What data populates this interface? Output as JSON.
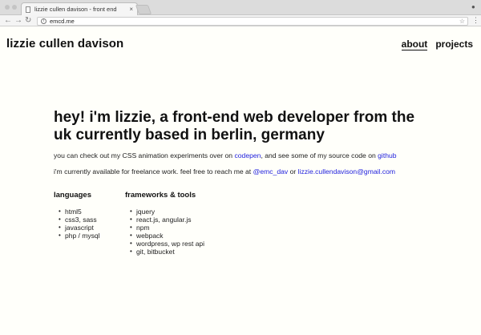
{
  "browser": {
    "tab_title": "lizzie cullen davison - front end",
    "tab_close": "×",
    "url": "emcd.me",
    "back": "←",
    "forward": "→",
    "reload": "↻",
    "star": "☆",
    "menu": "⋮",
    "info": "i"
  },
  "header": {
    "site_title": "lizzie cullen davison",
    "nav": [
      {
        "label": "about",
        "active": true
      },
      {
        "label": "projects",
        "active": false
      }
    ]
  },
  "main": {
    "heading": "hey! i'm lizzie, a front-end web developer from the uk currently based in berlin, germany",
    "para1": {
      "before": "you can check out my CSS animation experiments over on ",
      "link1": "codepen",
      "middle": ", and see some of my source code on ",
      "link2": "github"
    },
    "para2": {
      "before": "i'm currently available for freelance work. feel free to reach me at ",
      "link1": "@emc_dav",
      "middle": " or ",
      "link2": "lizzie.cullendavison@gmail.com"
    },
    "languages": {
      "title": "languages",
      "items": [
        "html5",
        "css3, sass",
        "javascript",
        "php / mysql"
      ]
    },
    "frameworks": {
      "title": "frameworks & tools",
      "items": [
        "jquery",
        "react.js, angular.js",
        "npm",
        "webpack",
        "wordpress, wp rest api",
        "git, bitbucket"
      ]
    }
  },
  "colors": {
    "link": "#2222dd",
    "background": "#fffffa"
  }
}
